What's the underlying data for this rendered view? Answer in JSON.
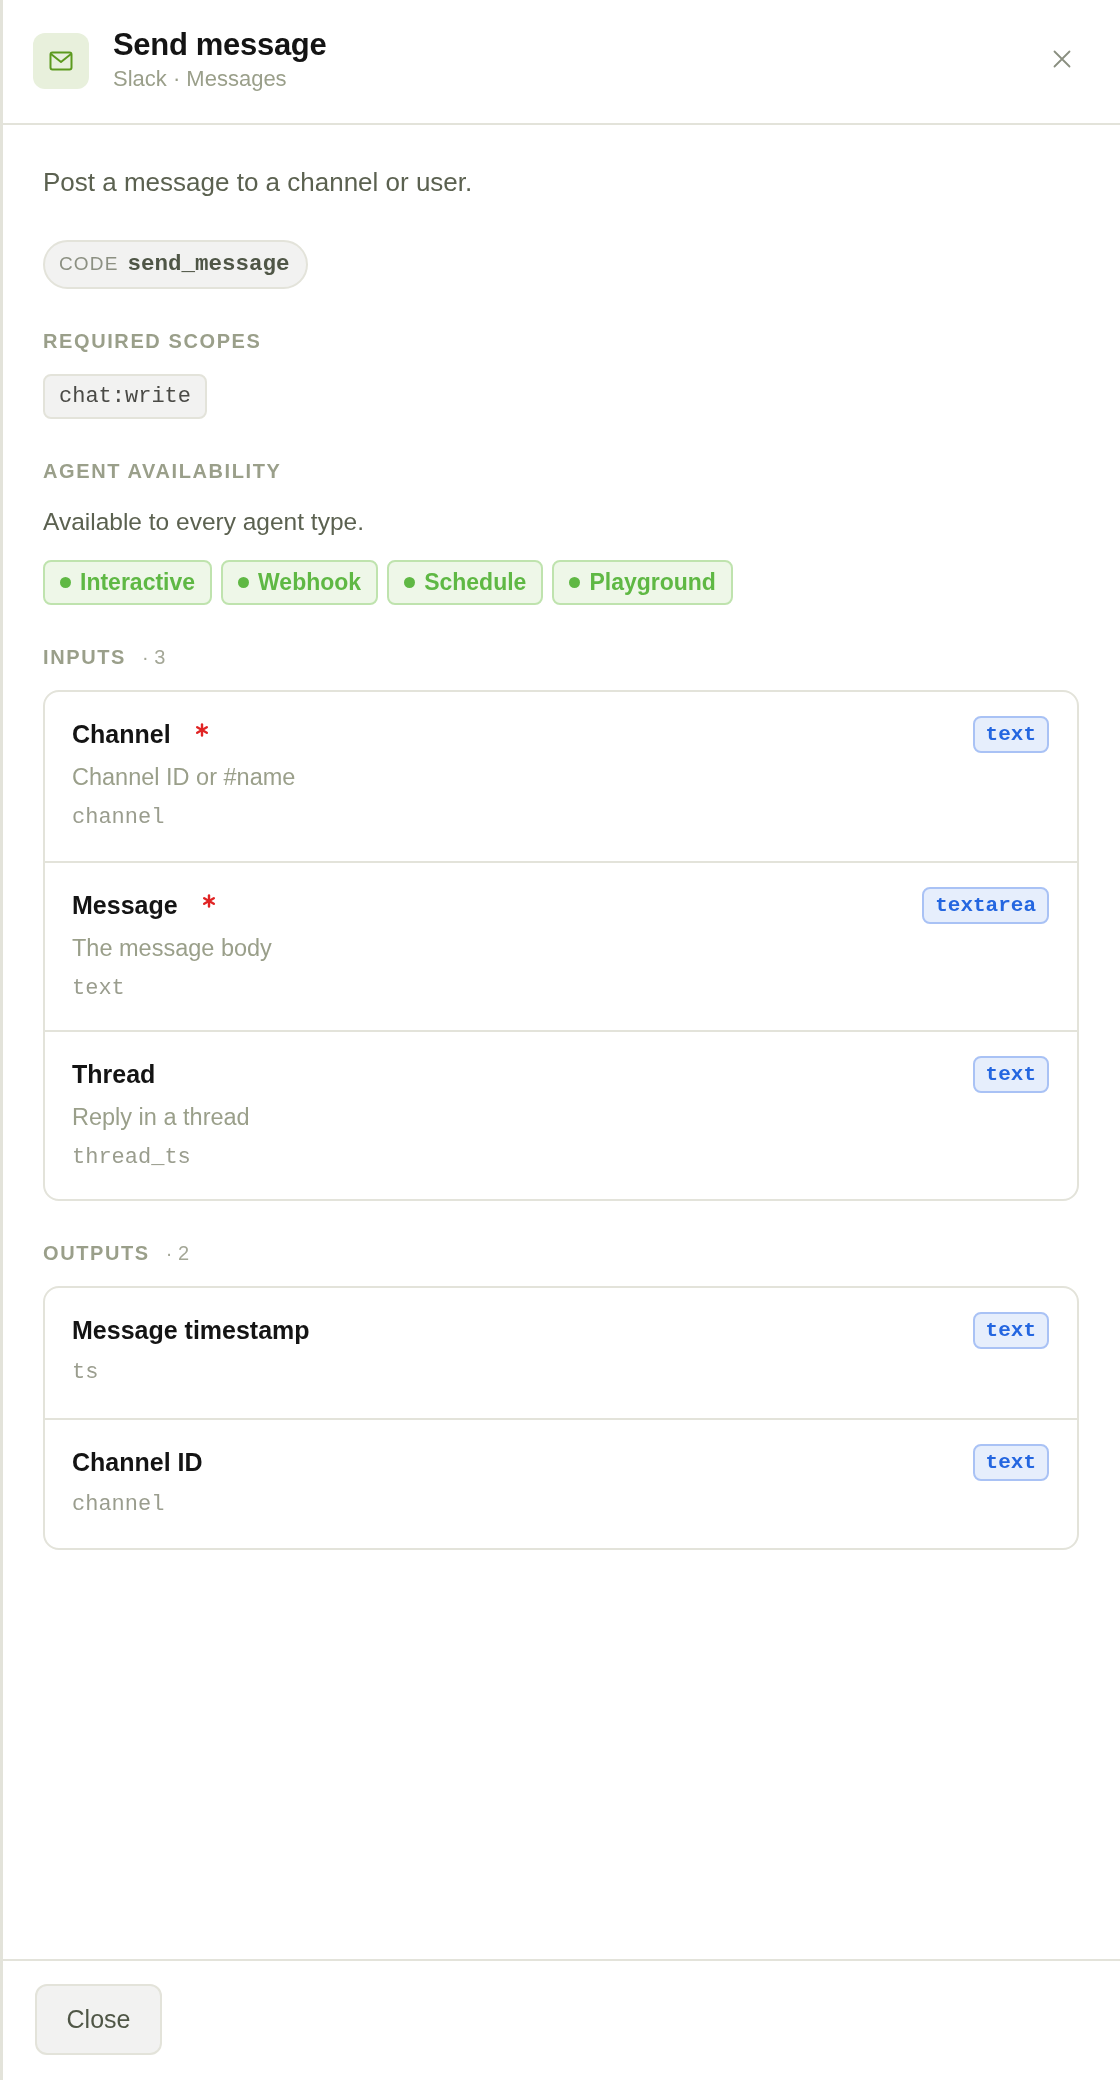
{
  "header": {
    "title": "Send message",
    "subtitle": "Slack · Messages"
  },
  "description": "Post a message to a channel or user.",
  "code": {
    "label": "CODE",
    "value": "send_message"
  },
  "required_scopes": {
    "heading": "REQUIRED SCOPES",
    "scopes": [
      "chat:write"
    ]
  },
  "agent_availability": {
    "heading": "AGENT AVAILABILITY",
    "note": "Available to every agent type.",
    "agent_types": [
      "Interactive",
      "Webhook",
      "Schedule",
      "Playground"
    ]
  },
  "inputs": {
    "heading": "INPUTS",
    "count": "· 3",
    "items": [
      {
        "label": "Channel",
        "required": true,
        "description": "Channel ID or #name",
        "key": "channel",
        "type": "text"
      },
      {
        "label": "Message",
        "required": true,
        "description": "The message body",
        "key": "text",
        "type": "textarea"
      },
      {
        "label": "Thread",
        "required": false,
        "description": "Reply in a thread",
        "key": "thread_ts",
        "type": "text"
      }
    ]
  },
  "outputs": {
    "heading": "OUTPUTS",
    "count": "· 2",
    "items": [
      {
        "label": "Message timestamp",
        "key": "ts",
        "type": "text"
      },
      {
        "label": "Channel ID",
        "key": "channel",
        "type": "text"
      }
    ]
  },
  "footer": {
    "buttons": [
      "Close"
    ]
  }
}
